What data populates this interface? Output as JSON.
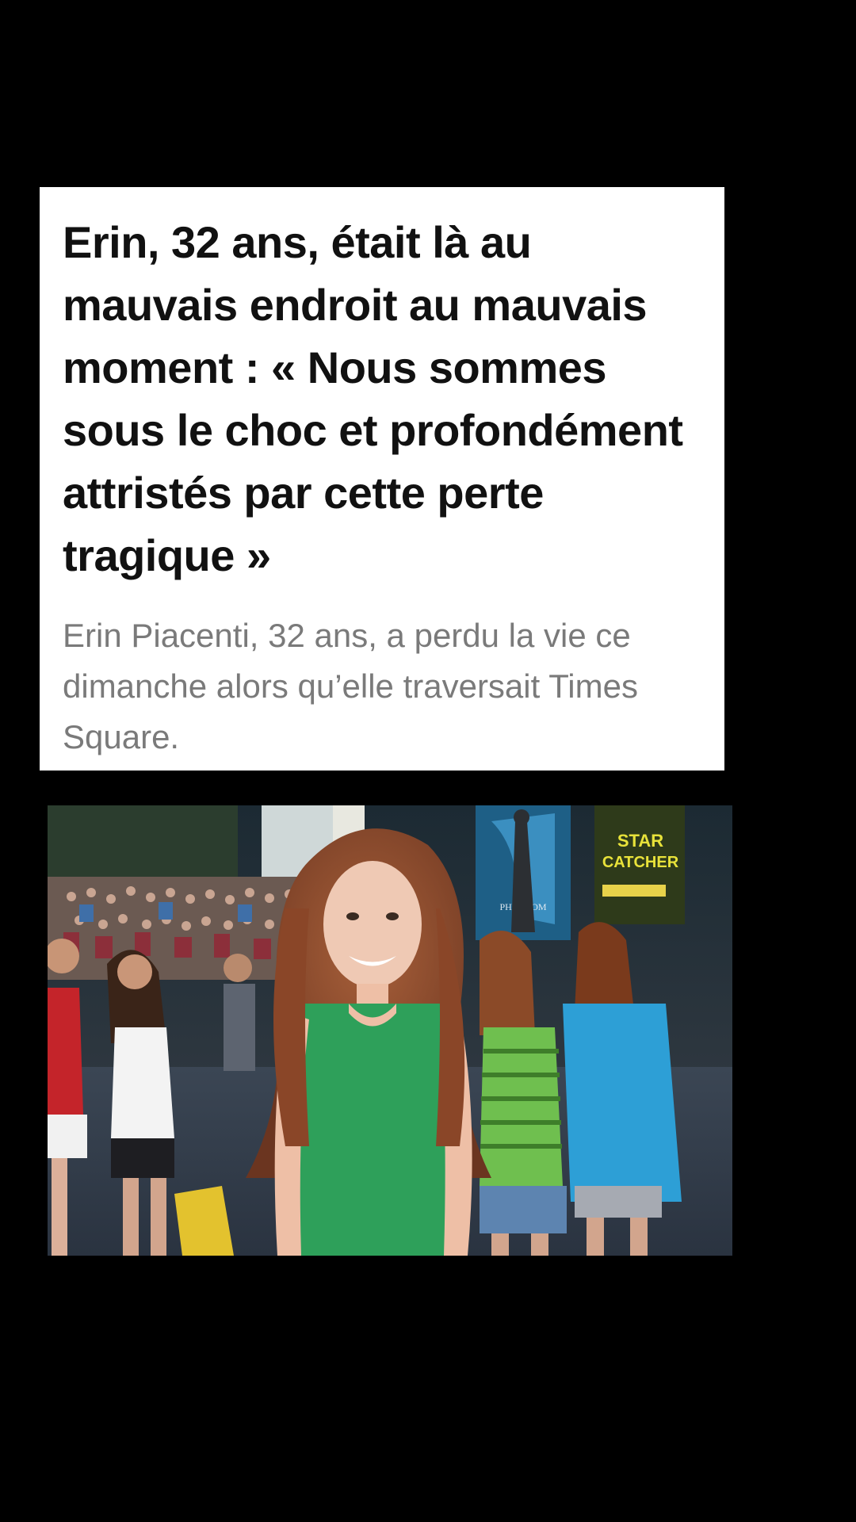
{
  "article": {
    "headline": "Erin, 32 ans, était là au mauvais endroit au mauvais moment : « Nous sommes sous le choc et profondément attristés par cette perte tragique »",
    "lede": "Erin Piacenti, 32 ans, a perdu la vie ce dimanche alors qu’elle traversait Times Square."
  },
  "photo": {
    "sign_line1": "STAR",
    "sign_line2": "CATCHER",
    "poster_text": "PHANTOM"
  }
}
